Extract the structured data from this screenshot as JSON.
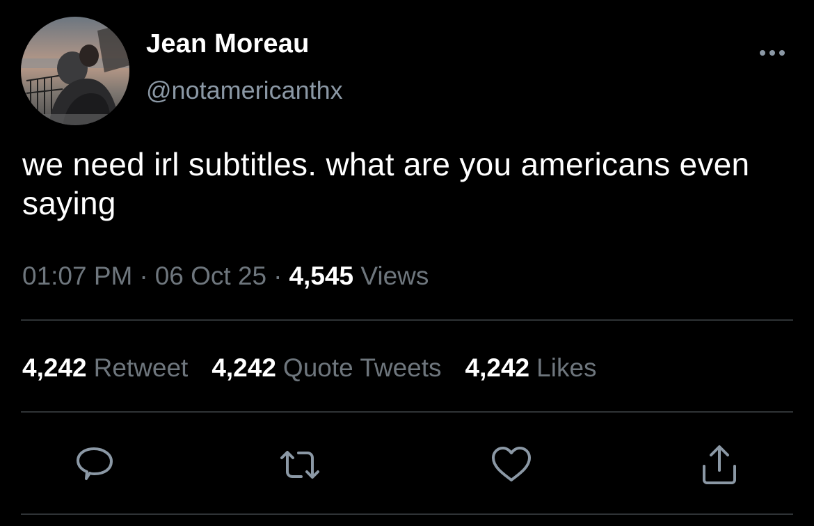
{
  "author": {
    "display_name": "Jean Moreau",
    "handle": "@notamericanthx",
    "avatar": "profile-photo"
  },
  "tweet": {
    "text": "we need irl subtitles. what are you americans even saying",
    "time": "01:07 PM",
    "separator": "·",
    "date": "06 Oct 25",
    "views_count": "4,545",
    "views_label": "Views"
  },
  "stats": [
    {
      "count": "4,242",
      "label": "Retweet"
    },
    {
      "count": "4,242",
      "label": "Quote Tweets"
    },
    {
      "count": "4,242",
      "label": "Likes"
    }
  ],
  "actions": {
    "reply": "reply-icon",
    "retweet": "retweet-icon",
    "like": "heart-icon",
    "share": "share-icon"
  },
  "colors": {
    "background": "#000000",
    "primary_text": "#ffffff",
    "secondary_text": "#8b98a5",
    "muted_text": "#6e767d",
    "divider": "#2f3336"
  }
}
